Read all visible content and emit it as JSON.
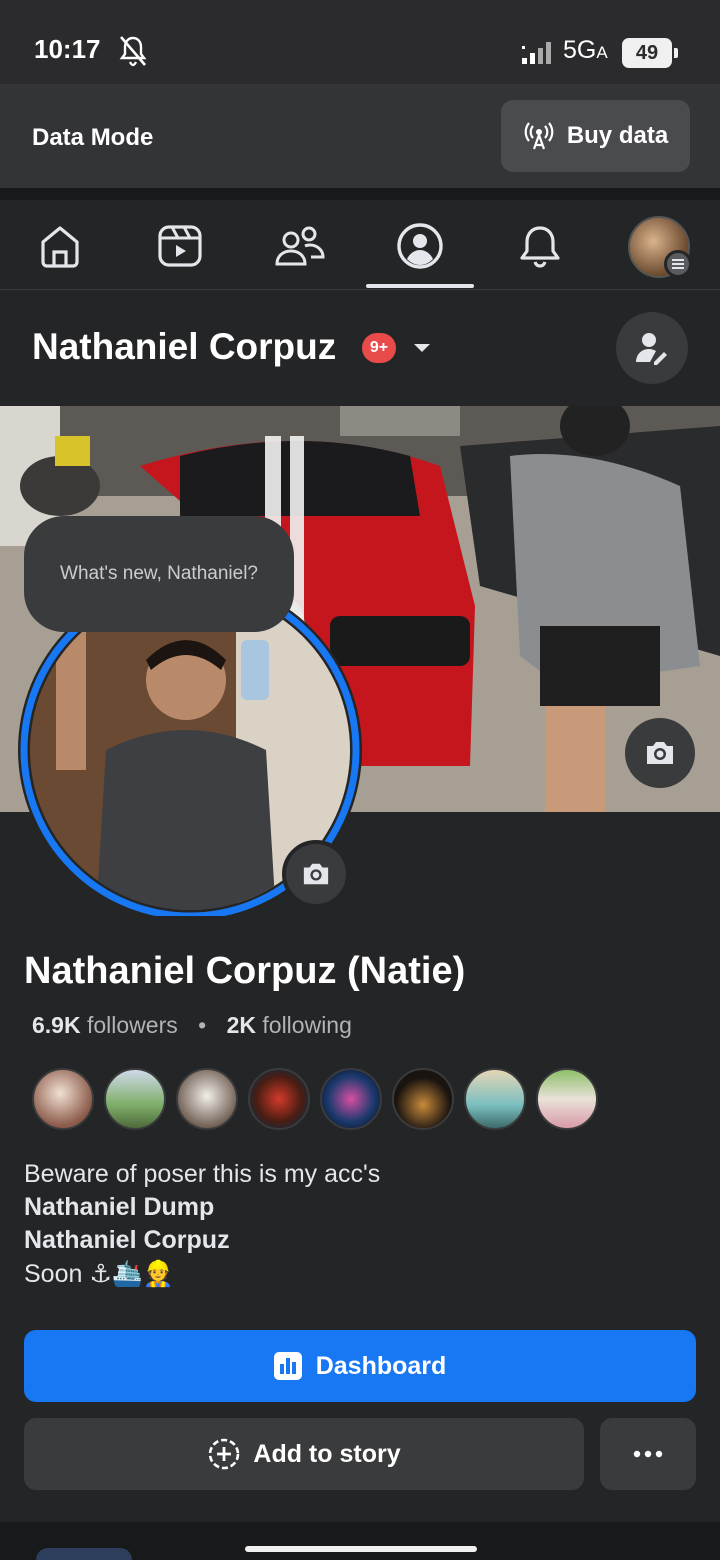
{
  "status_bar": {
    "time": "10:17",
    "network": "5G",
    "network_sub": "A",
    "battery": "49"
  },
  "data_bar": {
    "mode_label": "Data Mode",
    "buy_label": "Buy data"
  },
  "nav": {
    "items": [
      {
        "icon": "home-icon",
        "active": false
      },
      {
        "icon": "reels-icon",
        "active": false
      },
      {
        "icon": "friends-icon",
        "active": false
      },
      {
        "icon": "profile-icon",
        "active": true
      },
      {
        "icon": "bell-icon",
        "active": false
      },
      {
        "icon": "menu-avatar",
        "active": false
      }
    ]
  },
  "profile": {
    "header_name": "Nathaniel Corpuz",
    "notif_badge": "9+",
    "composer_prompt": "What's new, Nathaniel?",
    "full_name": "Nathaniel Corpuz (Natie)",
    "followers_count": "6.9K",
    "followers_label": "followers",
    "following_count": "2K",
    "following_label": "following",
    "bio_line1": "Beware of poser this is my acc's",
    "bio_line2": "Nathaniel Dump",
    "bio_line3": "Nathaniel Corpuz",
    "bio_line4_text": "Soon",
    "bio_line4_emoji": "⚓🛳️👷"
  },
  "actions": {
    "dashboard_label": "Dashboard",
    "add_story_label": "Add to story"
  },
  "colors": {
    "accent": "#1877f2",
    "background": "#242526",
    "badge": "#e94b4b"
  }
}
